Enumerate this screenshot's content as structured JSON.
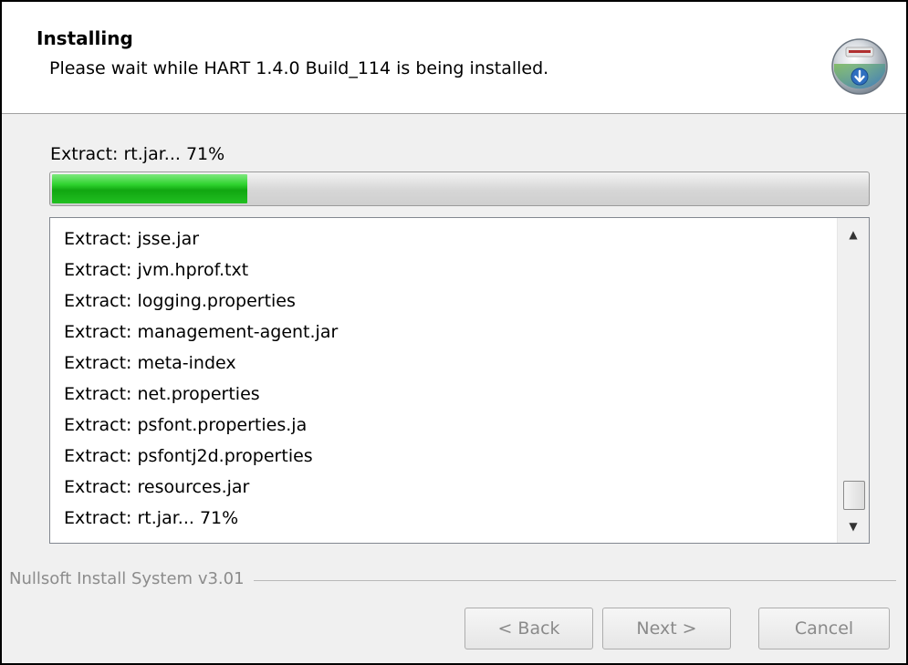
{
  "header": {
    "title": "Installing",
    "subtitle": "Please wait while HART 1.4.0 Build_114 is being installed.",
    "icon": "installer-disc-icon"
  },
  "status": {
    "text": "Extract: rt.jar... 71%",
    "progress_fraction": 0.24
  },
  "log": {
    "entries": [
      "Extract: jsse.jar",
      "Extract: jvm.hprof.txt",
      "Extract: logging.properties",
      "Extract: management-agent.jar",
      "Extract: meta-index",
      "Extract: net.properties",
      "Extract: psfont.properties.ja",
      "Extract: psfontj2d.properties",
      "Extract: resources.jar",
      "Extract: rt.jar... 71%"
    ]
  },
  "footer": {
    "branding": "Nullsoft Install System v3.01",
    "back_label": "< Back",
    "next_label": "Next >",
    "cancel_label": "Cancel"
  },
  "colors": {
    "progress_green": "#21c021",
    "window_bg": "#f0f0f0",
    "disabled_text": "#8a8a8a"
  }
}
